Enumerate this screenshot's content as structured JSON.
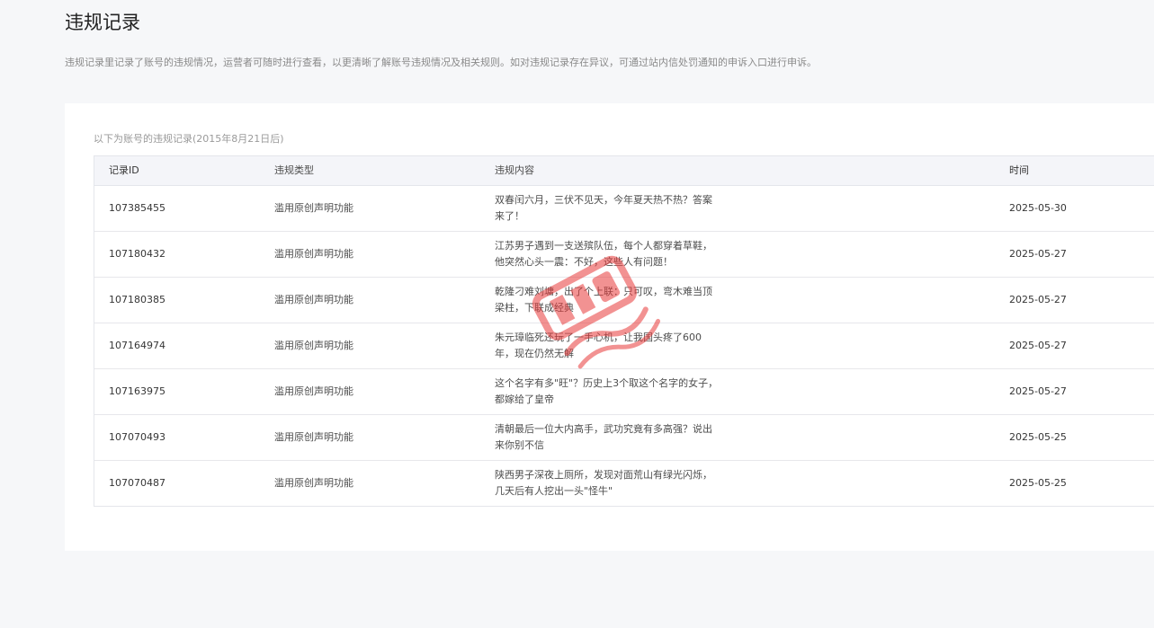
{
  "page": {
    "title": "违规记录",
    "description": "违规记录里记录了账号的违规情况，运营者可随时进行查看，以更清晰了解账号违规情况及相关规则。如对违规记录存在异议，可通过站内信处罚通知的申诉入口进行申诉。"
  },
  "records": {
    "caption": "以下为账号的违规记录(2015年8月21日后)",
    "columns": {
      "id": "记录ID",
      "type": "违规类型",
      "content": "违规内容",
      "time": "时间"
    },
    "rows": [
      {
        "id": "107385455",
        "type": "滥用原创声明功能",
        "content": "双春闰六月，三伏不见天，今年夏天热不热？答案来了！",
        "time": "2025-05-30"
      },
      {
        "id": "107180432",
        "type": "滥用原创声明功能",
        "content": "江苏男子遇到一支送殡队伍，每个人都穿着草鞋，他突然心头一震：不好，这些人有问题！",
        "time": "2025-05-27"
      },
      {
        "id": "107180385",
        "type": "滥用原创声明功能",
        "content": "乾隆刁难刘墉，出了个上联：只可叹，弯木难当顶梁柱，下联成经典",
        "time": "2025-05-27"
      },
      {
        "id": "107164974",
        "type": "滥用原创声明功能",
        "content": "朱元璋临死还玩了一手心机，让我国头疼了600年，现在仍然无解",
        "time": "2025-05-27"
      },
      {
        "id": "107163975",
        "type": "滥用原创声明功能",
        "content": "这个名字有多\"旺\"？历史上3个取这个名字的女子，都嫁给了皇帝",
        "time": "2025-05-27"
      },
      {
        "id": "107070493",
        "type": "滥用原创声明功能",
        "content": "清朝最后一位大内高手，武功究竟有多高强？说出来你别不信",
        "time": "2025-05-25"
      },
      {
        "id": "107070487",
        "type": "滥用原创声明功能",
        "content": "陕西男子深夜上厕所，发现对面荒山有绿光闪烁，几天后有人挖出一头\"怪牛\"",
        "time": "2025-05-25"
      }
    ]
  },
  "watermark": {
    "color": "#e83a3a"
  }
}
